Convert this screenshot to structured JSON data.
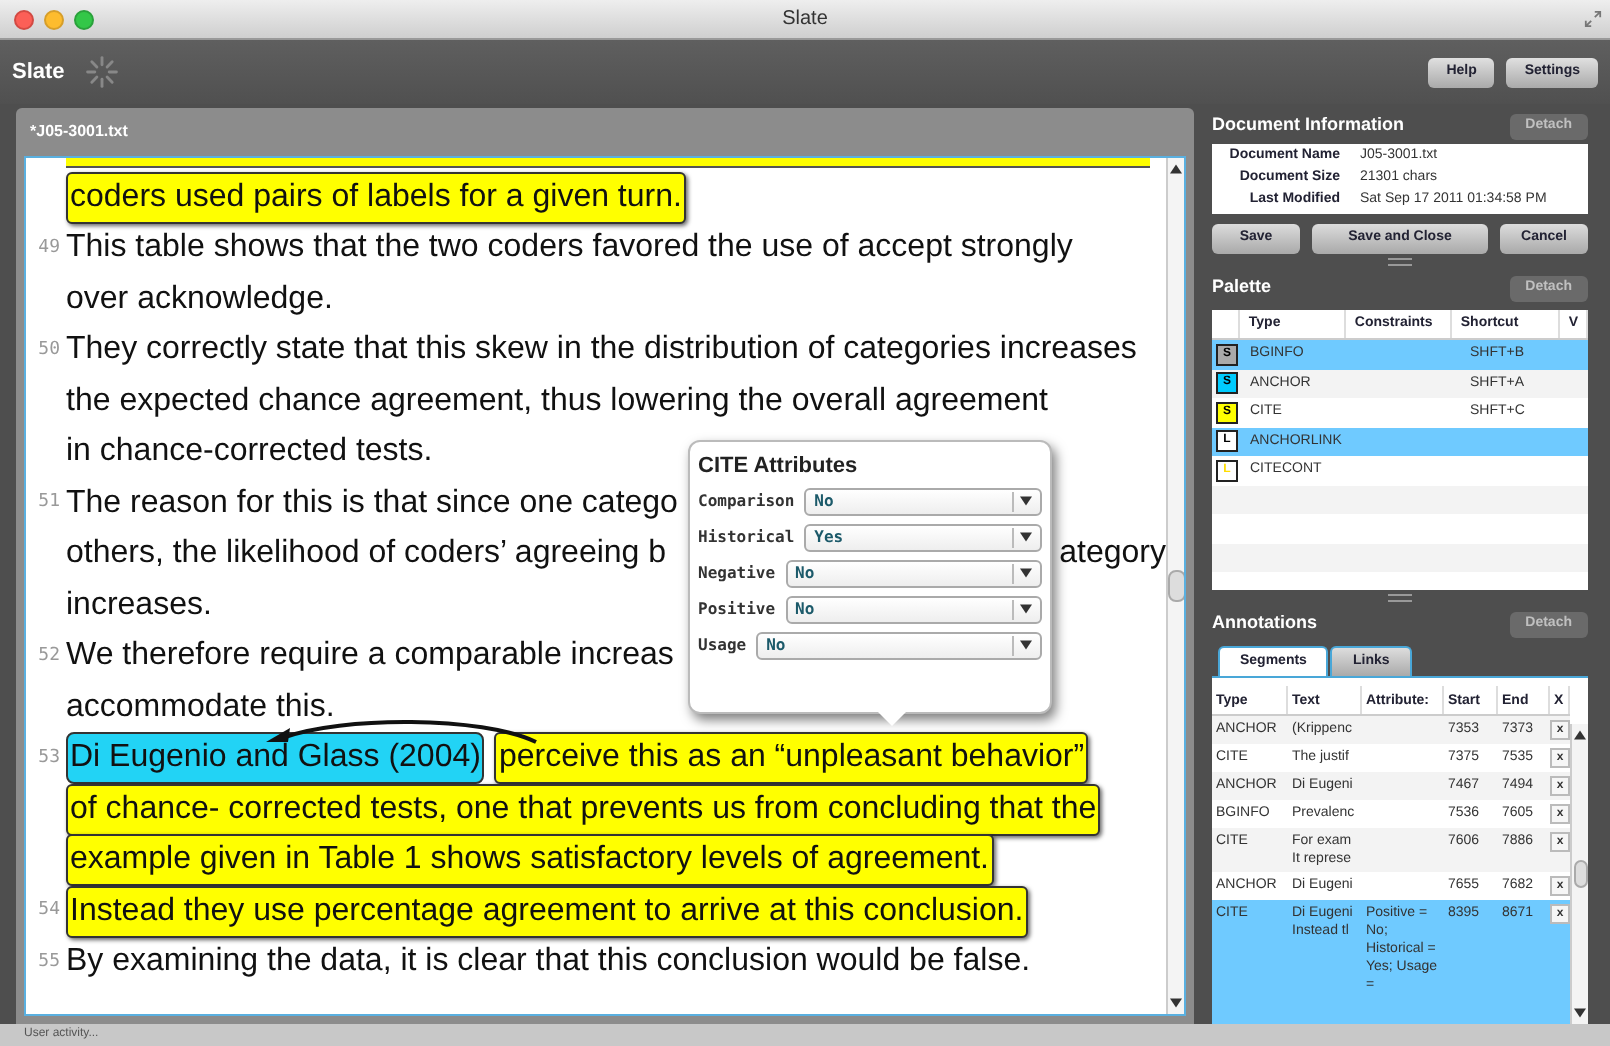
{
  "window": {
    "title": "Slate"
  },
  "toolbar": {
    "app_name": "Slate",
    "buttons": [
      "Help",
      "Settings"
    ]
  },
  "document": {
    "tab_title": "*J05-3001.txt",
    "lines": [
      {
        "segments": [
          {
            "kind": "cite",
            "text": "coders used pairs of labels for a given turn."
          }
        ]
      },
      {
        "number": "49",
        "segments": [
          {
            "kind": "plain",
            "text": "This table shows that the two coders favored the use of accept strongly"
          }
        ]
      },
      {
        "segments": [
          {
            "kind": "plain",
            "text": "over acknowledge."
          }
        ]
      },
      {
        "number": "50",
        "segments": [
          {
            "kind": "plain",
            "text": "They correctly state that this skew in the distribution of categories increases"
          }
        ]
      },
      {
        "segments": [
          {
            "kind": "plain",
            "text": "the expected chance agreement, thus lowering the overall agreement"
          }
        ]
      },
      {
        "segments": [
          {
            "kind": "plain",
            "text": "in chance-corrected tests."
          }
        ]
      },
      {
        "number": "51",
        "segments": [
          {
            "kind": "plain",
            "text": "The reason for this is that since one catego"
          }
        ]
      },
      {
        "segments": [
          {
            "kind": "plain",
            "text": "others, the likelihood of coders’ agreeing b"
          }
        ],
        "tail": "ategory"
      },
      {
        "segments": [
          {
            "kind": "plain",
            "text": "increases."
          }
        ]
      },
      {
        "number": "52",
        "segments": [
          {
            "kind": "plain",
            "text": "We therefore require a comparable increas"
          }
        ]
      },
      {
        "segments": [
          {
            "kind": "plain",
            "text": "accommodate this."
          }
        ]
      },
      {
        "number": "53",
        "segments": [
          {
            "kind": "anchor",
            "text": "Di Eugenio and Glass (2004)"
          },
          {
            "kind": "cite",
            "text": "perceive this as an “unpleasant behavior”"
          }
        ]
      },
      {
        "segments": [
          {
            "kind": "cite",
            "text": "of chance- corrected tests, one that prevents us from concluding that the"
          }
        ]
      },
      {
        "segments": [
          {
            "kind": "cite",
            "text": "example given in Table 1 shows satisfactory levels of agreement."
          }
        ]
      },
      {
        "number": "54",
        "segments": [
          {
            "kind": "cite",
            "text": "Instead they use percentage agreement to arrive at this conclusion."
          }
        ]
      },
      {
        "number": "55",
        "segments": [
          {
            "kind": "plain",
            "text": "By examining the data, it is clear that this conclusion would be false."
          }
        ]
      }
    ]
  },
  "attributes_popup": {
    "title": "CITE Attributes",
    "fields": [
      {
        "label": "Comparison",
        "value": "No"
      },
      {
        "label": "Historical",
        "value": "Yes"
      },
      {
        "label": "Negative",
        "value": "No"
      },
      {
        "label": "Positive",
        "value": "No"
      },
      {
        "label": "Usage",
        "value": "No"
      }
    ]
  },
  "document_information": {
    "title": "Document Information",
    "detach": "Detach",
    "rows": [
      {
        "label": "Document Name",
        "value": "J05-3001.txt"
      },
      {
        "label": "Document Size",
        "value": "21301 chars"
      },
      {
        "label": "Last Modified",
        "value": "Sat Sep 17 2011 01:34:58 PM"
      }
    ],
    "buttons": [
      "Save",
      "Save and Close",
      "Cancel"
    ]
  },
  "palette": {
    "title": "Palette",
    "detach": "Detach",
    "columns": [
      "Type",
      "Constraints",
      "Shortcut",
      "V"
    ],
    "rows": [
      {
        "kind": "segment",
        "letter": "S",
        "color": "#aaaaaa",
        "type": "BGINFO",
        "shortcut": "SHFT+B",
        "selected": true
      },
      {
        "kind": "segment",
        "letter": "S",
        "color": "#00ccff",
        "type": "ANCHOR",
        "shortcut": "SHFT+A",
        "selected": false
      },
      {
        "kind": "segment",
        "letter": "S",
        "color": "#ffff00",
        "type": "CITE",
        "shortcut": "SHFT+C",
        "selected": false
      },
      {
        "kind": "link",
        "letter": "L",
        "color": "#000000",
        "type": "ANCHORLINK",
        "selected": true
      },
      {
        "kind": "link",
        "letter": "L",
        "color": "#ffdd00",
        "type": "CITECONT",
        "selected": false
      }
    ]
  },
  "annotations": {
    "title": "Annotations",
    "detach": "Detach",
    "tabs": [
      {
        "label": "Segments",
        "selected": true
      },
      {
        "label": "Links",
        "selected": false
      }
    ],
    "columns": [
      "Type",
      "Text",
      "Attribute:",
      "Start",
      "End",
      "X"
    ],
    "rows": [
      {
        "type": "ANCHOR",
        "text": "(Krippenc",
        "start": "7353",
        "end": "7373",
        "delete": "x",
        "selected": false
      },
      {
        "type": "CITE",
        "text": "The justif",
        "start": "7375",
        "end": "7535",
        "delete": "x",
        "selected": false
      },
      {
        "type": "ANCHOR",
        "text": "Di Eugeni",
        "start": "7467",
        "end": "7494",
        "delete": "x",
        "selected": false
      },
      {
        "type": "BGINFO",
        "text": "Prevalenc",
        "start": "7536",
        "end": "7605",
        "delete": "x",
        "selected": false
      },
      {
        "type": "CITE",
        "text": "For exam It represe",
        "start": "7606",
        "end": "7886",
        "delete": "x",
        "selected": false
      },
      {
        "type": "ANCHOR",
        "text": "Di Eugeni",
        "start": "7655",
        "end": "7682",
        "delete": "x",
        "selected": false
      },
      {
        "type": "CITE",
        "text": "Di Eugeni Instead tl",
        "attributes": "Positive = No; Historical = Yes; Usage =",
        "start": "8395",
        "end": "8671",
        "delete": "x",
        "selected": true
      }
    ]
  },
  "status_bar": "User activity..."
}
